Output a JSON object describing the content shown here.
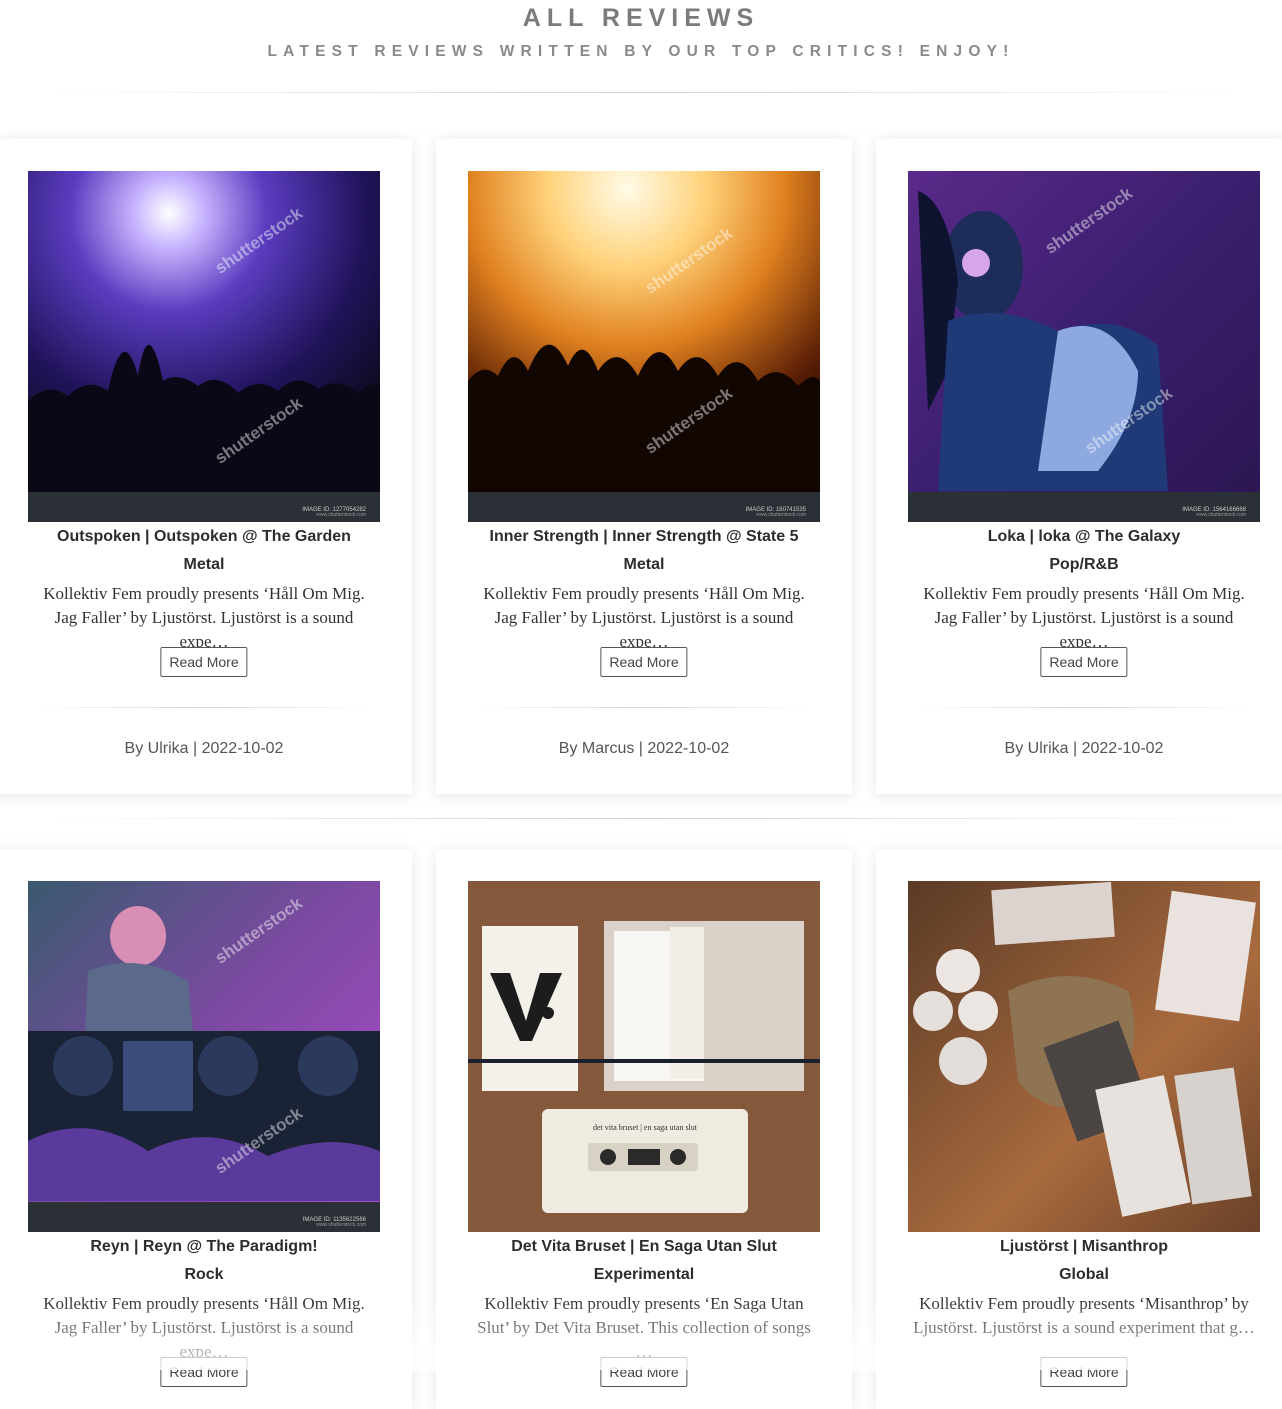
{
  "header": {
    "title": "ALL REVIEWS",
    "subtitle": "LATEST REVIEWS WRITTEN BY OUR TOP CRITICS! ENJOY!"
  },
  "reviews": [
    {
      "heading": "Outspoken | Outspoken @ The Garden",
      "genre": "Metal",
      "excerpt": "Kollektiv Fem proudly presents ‘Håll Om Mig. Jag Faller’ by Ljustörst. Ljustörst is a sound expe…",
      "read_more": "Read More",
      "meta": "By Ulrika | 2022-10-02",
      "image_id": "IMAGE ID: 1277054282",
      "image_site": "www.shutterstock.com",
      "watermark": "shutterstock"
    },
    {
      "heading": "Inner Strength | Inner Strength @ State 5",
      "genre": "Metal",
      "excerpt": "Kollektiv Fem proudly presents ‘Håll Om Mig. Jag Faller’ by Ljustörst. Ljustörst is a sound expe…",
      "read_more": "Read More",
      "meta": "By Marcus | 2022-10-02",
      "image_id": "IMAGE ID: 160741535",
      "image_site": "www.shutterstock.com",
      "watermark": "shutterstock"
    },
    {
      "heading": "Loka | loka @ The Galaxy",
      "genre": "Pop/R&B",
      "excerpt": "Kollektiv Fem proudly presents ‘Håll Om Mig. Jag Faller’ by Ljustörst. Ljustörst is a sound expe…",
      "read_more": "Read More",
      "meta": "By Ulrika | 2022-10-02",
      "image_id": "IMAGE ID: 1564166668",
      "image_site": "www.shutterstock.com",
      "watermark": "shutterstock"
    },
    {
      "heading": "Reyn | Reyn @ The Paradigm!",
      "genre": "Rock",
      "excerpt": "Kollektiv Fem proudly presents ‘Håll Om Mig. Jag Faller’ by Ljustörst. Ljustörst is a sound expe…",
      "read_more": "Read More",
      "meta": "",
      "image_id": "IMAGE ID: 1135622566",
      "image_site": "www.shutterstock.com",
      "watermark": "shutterstock"
    },
    {
      "heading": "Det Vita Bruset | En Saga Utan Slut",
      "genre": "Experimental",
      "excerpt": "Kollektiv Fem proudly presents ‘En Saga Utan Slut’ by Det Vita Bruset. This collection of songs …",
      "read_more": "Read More",
      "meta": "",
      "cassette_label": "det vita bruset | en saga utan slut"
    },
    {
      "heading": "Ljustörst | Misanthrop",
      "genre": "Global",
      "excerpt": "Kollektiv Fem proudly presents ‘Misanthrop’ by Ljustörst. Ljustörst is a sound experiment that g…",
      "read_more": "Read More",
      "meta": ""
    }
  ]
}
